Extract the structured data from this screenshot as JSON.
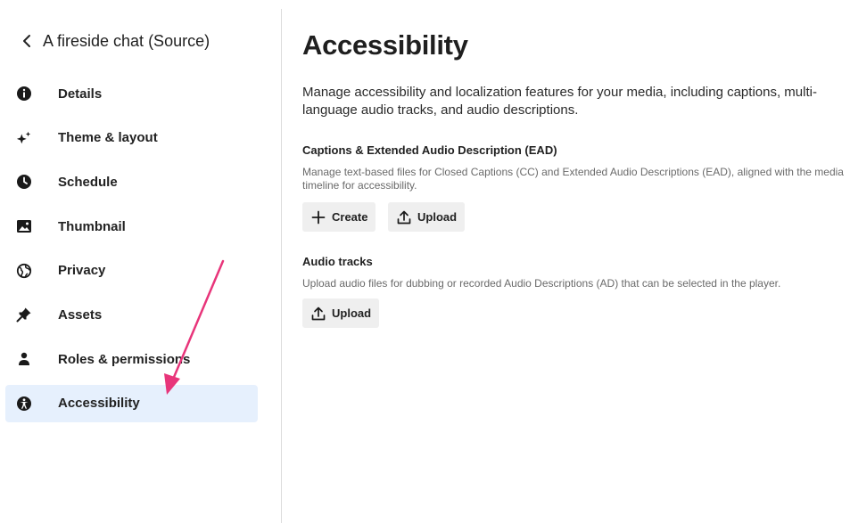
{
  "sidebar": {
    "back_title": "A fireside chat (Source)",
    "items": [
      {
        "label": "Details",
        "icon": "info-icon"
      },
      {
        "label": "Theme & layout",
        "icon": "sparkle-icon"
      },
      {
        "label": "Schedule",
        "icon": "clock-icon"
      },
      {
        "label": "Thumbnail",
        "icon": "image-icon"
      },
      {
        "label": "Privacy",
        "icon": "globe-icon"
      },
      {
        "label": "Assets",
        "icon": "pin-icon"
      },
      {
        "label": "Roles & permissions",
        "icon": "person-icon"
      },
      {
        "label": "Accessibility",
        "icon": "accessibility-icon",
        "active": true
      }
    ]
  },
  "main": {
    "title": "Accessibility",
    "intro": "Manage accessibility and localization features for your media, including captions, multi-language audio tracks, and audio descriptions.",
    "captions": {
      "title": "Captions & Extended Audio Description (EAD)",
      "description": "Manage text-based files for Closed Captions (CC) and Extended Audio Descriptions (EAD), aligned with the media timeline for accessibility.",
      "create_label": "Create",
      "upload_label": "Upload"
    },
    "audio": {
      "title": "Audio tracks",
      "description": "Upload audio files for dubbing or recorded Audio Descriptions (AD) that can be selected in the player.",
      "upload_label": "Upload"
    }
  },
  "colors": {
    "active_bg": "#e6f0fd",
    "annotation_arrow": "#e8357a",
    "button_bg": "#efefef"
  }
}
